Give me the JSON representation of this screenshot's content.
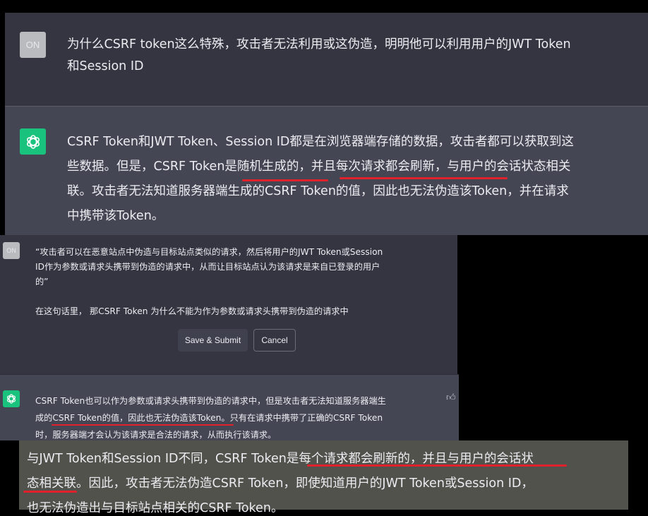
{
  "top": {
    "user_avatar": "ON",
    "question_line1": "为什么CSRF token这么特殊，攻击者无法利用或这伪造，明明他可以利用用户的JWT Token",
    "question_line2": "和Session ID",
    "answer_lines": [
      "CSRF Token和JWT Token、Session ID都是在浏览器端存储的数据，攻击者都可以获取到这",
      "些数据。但是，CSRF Token是随机生成的，并且每次请求都会刷新，与用户的会话状态相关",
      "联。攻击者无法知道服务器端生成的CSRF Token的值，因此也无法伪造该Token，并在请求",
      "中携带该Token。"
    ]
  },
  "edit": {
    "user_avatar": "ON",
    "quote_lines": [
      "“攻击者可以在恶意站点中伪造与目标站点类似的请求，然后将用户的JWT Token或Session",
      "ID作为参数或请求头携带到伪造的请求中，从而让目标站点认为该请求是来自已登录的用户",
      "的”"
    ],
    "question": "在这句话里，  那CSRF Token 为什么不能为作为参数或请求头携带到伪造的请求中",
    "save_label": "Save & Submit",
    "cancel_label": "Cancel"
  },
  "answer2": {
    "lines": [
      "CSRF Token也可以作为参数或请求头携带到伪造的请求中，但是攻击者无法知道服务器端生",
      "成的CSRF Token的值，因此也无法伪造该Token。只有在请求中携带了正确的CSRF Token",
      "时，服务器端才会认为该请求是合法的请求，从而执行该请求。"
    ]
  },
  "bottom": {
    "lines": [
      "与JWT Token和Session ID不同，CSRF Token是每个请求都会刷新的，并且与用户的会话状",
      "态相关联。因此，攻击者无法伪造CSRF Token，即使知道用户的JWT Token或Session ID，",
      "也无法伪造出与目标站点相关的CSRF Token。"
    ]
  },
  "colors": {
    "user_bg": "#343541",
    "ai_bg": "#444654",
    "bottom_bg": "#51524c",
    "accent": "#19c37d",
    "underline": "#e0212b"
  }
}
